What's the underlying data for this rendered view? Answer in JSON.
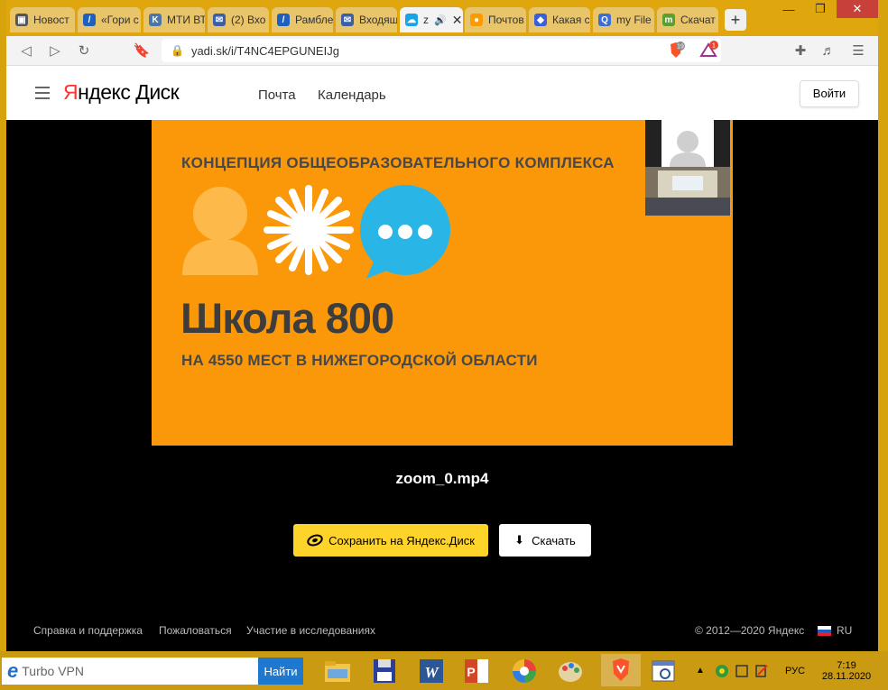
{
  "tabs": [
    {
      "title": "Новост",
      "color": "#555555"
    },
    {
      "title": "«Гори с",
      "color": "#1f5fbf"
    },
    {
      "title": "МТИ ВТ",
      "color": "#4a76a8"
    },
    {
      "title": "(2) Вхо",
      "color": "#3a5fa8"
    },
    {
      "title": "Рамбле",
      "color": "#1f5fbf"
    },
    {
      "title": "Входящ",
      "color": "#3a5fa8"
    },
    {
      "title": "z",
      "color": "#1aa3e8"
    },
    {
      "title": "Почтов",
      "color": "#ff9900"
    },
    {
      "title": "Какая с",
      "color": "#3a5fd8"
    },
    {
      "title": "my File",
      "color": "#3a6fd8"
    },
    {
      "title": "Скачат",
      "color": "#5aa02c"
    }
  ],
  "url": "yadi.sk/i/T4NC4EPGUNEIJg",
  "brave_shield_count": "19",
  "rewards_count": "1",
  "site": {
    "logo_first": "Я",
    "logo_rest": "ндекс Диск",
    "nav": [
      "Почта",
      "Календарь"
    ],
    "login": "Войти"
  },
  "slide": {
    "line1": "КОНЦЕПЦИЯ ОБЩЕОБРАЗОВАТЕЛЬНОГО КОМПЛЕКСА",
    "title": "Школа 800",
    "subtitle": "НА 4550 МЕСТ В НИЖЕГОРОДСКОЙ ОБЛАСТИ"
  },
  "file_name": "zoom_0.mp4",
  "buttons": {
    "save": "Сохранить на Яндекс.Диск",
    "download": "Скачать"
  },
  "footer": {
    "links": [
      "Справка и поддержка",
      "Пожаловаться",
      "Участие в исследованиях"
    ],
    "copyright": "© 2012—2020 Яндекс",
    "lang": "RU"
  },
  "taskbar": {
    "search_text": "Turbo VPN",
    "search_button": "Найти",
    "lang": "РУС",
    "time": "7:19",
    "date": "28.11.2020"
  }
}
